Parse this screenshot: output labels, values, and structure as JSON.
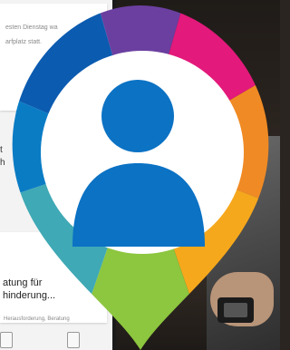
{
  "tablet": {
    "snippet_top_1": "esten Dienstag wa",
    "snippet_top_2": "arfplatz statt.",
    "side_line_1": "t",
    "side_line_2": "h",
    "headline_1": "atung für",
    "headline_2": "hinderung...",
    "snippet_bottom": "Herausforderung, Beratung"
  },
  "pin": {
    "icon": "user-location-pin-icon",
    "colors": {
      "purple": "#6b3fa0",
      "magenta": "#e3197b",
      "orange": "#f08a24",
      "amber": "#f6a81c",
      "green": "#8dc63f",
      "teal": "#3fa9b5",
      "blue": "#0072bc",
      "darkblue": "#0b5bb0",
      "person": "#0b72c4"
    }
  }
}
